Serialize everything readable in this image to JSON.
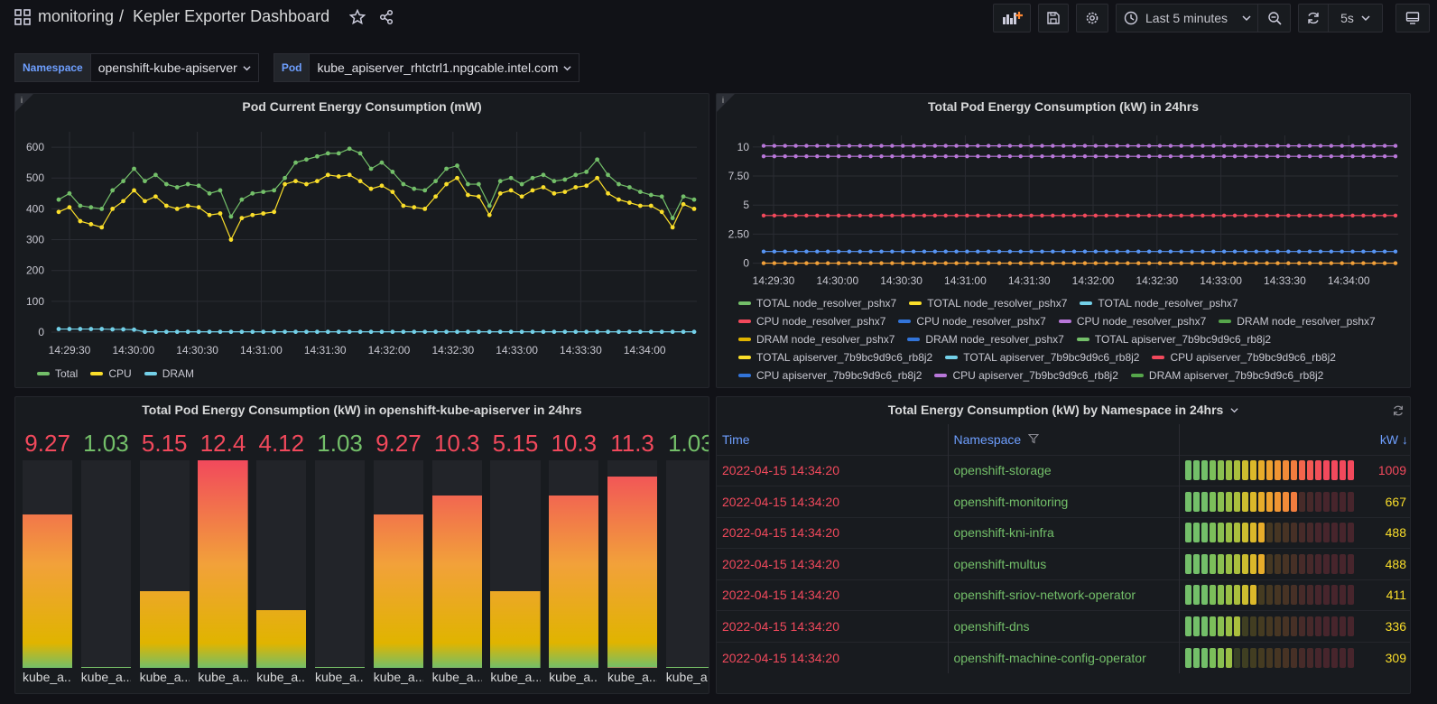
{
  "header": {
    "folder": "monitoring",
    "separator": "/",
    "title": "Kepler Exporter Dashboard",
    "time_range": "Last 5 minutes",
    "refresh_interval": "5s"
  },
  "variables": [
    {
      "label": "Namespace",
      "value": "openshift-kube-apiserver"
    },
    {
      "label": "Pod",
      "value": "kube_apiserver_rhtctrl1.npgcable.intel.com"
    }
  ],
  "colors": {
    "green": "#73bf69",
    "yellow": "#fade2a",
    "orange": "#f2a13a",
    "red": "#f2495c",
    "blue": "#5794f2",
    "lightblue": "#73d0e8",
    "purple": "#b877d9",
    "darkgreen": "#56a64b",
    "darkblue": "#3274d9",
    "darkyellow": "#e0b400"
  },
  "panel1": {
    "title": "Pod Current Energy Consumption (mW)",
    "info_icon": "info-icon",
    "legend": [
      {
        "label": "Total",
        "color": "#73bf69"
      },
      {
        "label": "CPU",
        "color": "#fade2a"
      },
      {
        "label": "DRAM",
        "color": "#73d0e8"
      }
    ]
  },
  "panel2": {
    "title": "Total Pod Energy Consumption (kW) in 24hrs",
    "info_icon": "info-icon",
    "legend": [
      {
        "label": "TOTAL node_resolver_pshx7",
        "color": "#73bf69"
      },
      {
        "label": "TOTAL node_resolver_pshx7",
        "color": "#fade2a"
      },
      {
        "label": "TOTAL node_resolver_pshx7",
        "color": "#73d0e8"
      },
      {
        "label": "CPU node_resolver_pshx7",
        "color": "#f2495c"
      },
      {
        "label": "CPU node_resolver_pshx7",
        "color": "#3274d9"
      },
      {
        "label": "CPU node_resolver_pshx7",
        "color": "#b877d9"
      },
      {
        "label": "DRAM node_resolver_pshx7",
        "color": "#56a64b"
      },
      {
        "label": "DRAM node_resolver_pshx7",
        "color": "#e0b400"
      },
      {
        "label": "DRAM node_resolver_pshx7",
        "color": "#3274d9"
      },
      {
        "label": "TOTAL apiserver_7b9bc9d9c6_rb8j2",
        "color": "#73bf69"
      },
      {
        "label": "TOTAL apiserver_7b9bc9d9c6_rb8j2",
        "color": "#fade2a"
      },
      {
        "label": "TOTAL apiserver_7b9bc9d9c6_rb8j2",
        "color": "#73d0e8"
      },
      {
        "label": "CPU apiserver_7b9bc9d9c6_rb8j2",
        "color": "#f2495c"
      },
      {
        "label": "CPU apiserver_7b9bc9d9c6_rb8j2",
        "color": "#3274d9"
      },
      {
        "label": "CPU apiserver_7b9bc9d9c6_rb8j2",
        "color": "#b877d9"
      },
      {
        "label": "DRAM apiserver_7b9bc9d9c6_rb8j2",
        "color": "#56a64b"
      },
      {
        "label": "DRAM apiserver_7b9bc9d9c6_rb8j2",
        "color": "#e0b400"
      }
    ]
  },
  "panel3": {
    "title": "Total Pod Energy Consumption (kW) in openshift-kube-apiserver in 24hrs",
    "gauges": [
      {
        "value": "9.27",
        "fill": 0.74,
        "label": "kube_a...",
        "color": "#f2495c"
      },
      {
        "value": "1.03",
        "fill": 0.0,
        "label": "kube_a...",
        "color": "#73bf69"
      },
      {
        "value": "5.15",
        "fill": 0.37,
        "label": "kube_a...",
        "color": "#f2495c"
      },
      {
        "value": "12.4",
        "fill": 1.0,
        "label": "kube_a...",
        "color": "#f2495c"
      },
      {
        "value": "4.12",
        "fill": 0.28,
        "label": "kube_a...",
        "color": "#f2495c"
      },
      {
        "value": "1.03",
        "fill": 0.0,
        "label": "kube_a...",
        "color": "#73bf69"
      },
      {
        "value": "9.27",
        "fill": 0.74,
        "label": "kube_a...",
        "color": "#f2495c"
      },
      {
        "value": "10.3",
        "fill": 0.83,
        "label": "kube_a...",
        "color": "#f2495c"
      },
      {
        "value": "5.15",
        "fill": 0.37,
        "label": "kube_a...",
        "color": "#f2495c"
      },
      {
        "value": "10.3",
        "fill": 0.83,
        "label": "kube_a...",
        "color": "#f2495c"
      },
      {
        "value": "11.3",
        "fill": 0.92,
        "label": "kube_a...",
        "color": "#f2495c"
      },
      {
        "value": "1.03",
        "fill": 0.0,
        "label": "kube_a...",
        "color": "#73bf69"
      }
    ]
  },
  "panel4": {
    "title": "Total Energy Consumption (kW) by Namespace in 24hrs",
    "columns": {
      "time": "Time",
      "namespace": "Namespace",
      "kw": "kW"
    },
    "rows": [
      {
        "time": "2022-04-15 14:34:20",
        "namespace": "openshift-storage",
        "kw": "1009",
        "level": 1.0,
        "kw_color": "#f2495c"
      },
      {
        "time": "2022-04-15 14:34:20",
        "namespace": "openshift-monitoring",
        "kw": "667",
        "level": 0.66,
        "kw_color": "#fade2a"
      },
      {
        "time": "2022-04-15 14:34:20",
        "namespace": "openshift-kni-infra",
        "kw": "488",
        "level": 0.48,
        "kw_color": "#fade2a"
      },
      {
        "time": "2022-04-15 14:34:20",
        "namespace": "openshift-multus",
        "kw": "488",
        "level": 0.48,
        "kw_color": "#fade2a"
      },
      {
        "time": "2022-04-15 14:34:20",
        "namespace": "openshift-sriov-network-operator",
        "kw": "411",
        "level": 0.41,
        "kw_color": "#fade2a"
      },
      {
        "time": "2022-04-15 14:34:20",
        "namespace": "openshift-dns",
        "kw": "336",
        "level": 0.33,
        "kw_color": "#fade2a"
      },
      {
        "time": "2022-04-15 14:34:20",
        "namespace": "openshift-machine-config-operator",
        "kw": "309",
        "level": 0.3,
        "kw_color": "#fade2a"
      }
    ]
  },
  "chart_data": [
    {
      "type": "line",
      "title": "Pod Current Energy Consumption (mW)",
      "ylim": [
        0,
        650
      ],
      "yticks": [
        "0",
        "100",
        "200",
        "300",
        "400",
        "500",
        "600"
      ],
      "xticks": [
        "14:29:30",
        "14:30:00",
        "14:30:30",
        "14:31:00",
        "14:31:30",
        "14:32:00",
        "14:32:30",
        "14:33:00",
        "14:33:30",
        "14:34:00"
      ],
      "series": [
        {
          "name": "Total",
          "color": "#73bf69",
          "values": [
            430,
            450,
            410,
            405,
            400,
            460,
            490,
            530,
            490,
            510,
            480,
            470,
            480,
            475,
            450,
            460,
            375,
            430,
            450,
            455,
            460,
            500,
            550,
            560,
            570,
            580,
            580,
            595,
            580,
            530,
            550,
            520,
            480,
            465,
            460,
            490,
            530,
            540,
            480,
            480,
            410,
            490,
            500,
            480,
            500,
            510,
            490,
            495,
            510,
            520,
            560,
            510,
            480,
            470,
            455,
            445,
            440,
            370,
            440,
            430
          ]
        },
        {
          "name": "CPU",
          "color": "#fade2a",
          "values": [
            390,
            405,
            360,
            350,
            340,
            400,
            425,
            460,
            425,
            440,
            410,
            400,
            410,
            405,
            380,
            385,
            300,
            370,
            380,
            385,
            390,
            480,
            490,
            480,
            490,
            510,
            505,
            510,
            490,
            465,
            475,
            455,
            410,
            405,
            400,
            440,
            480,
            500,
            445,
            440,
            380,
            450,
            460,
            440,
            460,
            470,
            450,
            455,
            470,
            475,
            500,
            450,
            430,
            420,
            410,
            410,
            390,
            340,
            415,
            400
          ]
        },
        {
          "name": "DRAM",
          "color": "#73d0e8",
          "values": [
            10,
            10,
            10,
            10,
            10,
            9,
            9,
            8,
            1,
            1,
            1,
            1,
            1,
            1,
            1,
            1,
            1,
            1,
            1,
            1,
            1,
            1,
            1,
            1,
            1,
            1,
            1,
            1,
            1,
            1,
            1,
            1,
            1,
            1,
            1,
            1,
            1,
            1,
            1,
            1,
            1,
            1,
            1,
            1,
            1,
            1,
            1,
            1,
            1,
            1,
            1,
            1,
            1,
            1,
            1,
            1,
            1,
            1,
            1,
            1
          ]
        }
      ]
    },
    {
      "type": "line",
      "title": "Total Pod Energy Consumption (kW) in 24hrs",
      "ylim": [
        -0.5,
        11
      ],
      "yticks": [
        "0",
        "2.50",
        "5",
        "7.50",
        "10"
      ],
      "xticks": [
        "14:29:30",
        "14:30:00",
        "14:30:30",
        "14:31:00",
        "14:31:30",
        "14:32:00",
        "14:32:30",
        "14:33:00",
        "14:33:30",
        "14:34:00"
      ],
      "series": [
        {
          "color": "#b877d9",
          "values_const": 10.1
        },
        {
          "color": "#b877d9",
          "values_const": 9.2
        },
        {
          "color": "#f2495c",
          "values_const": 4.1
        },
        {
          "color": "#5794f2",
          "values_const": 1.0
        },
        {
          "color": "#f2a13a",
          "values_const": 0.0
        }
      ]
    }
  ]
}
